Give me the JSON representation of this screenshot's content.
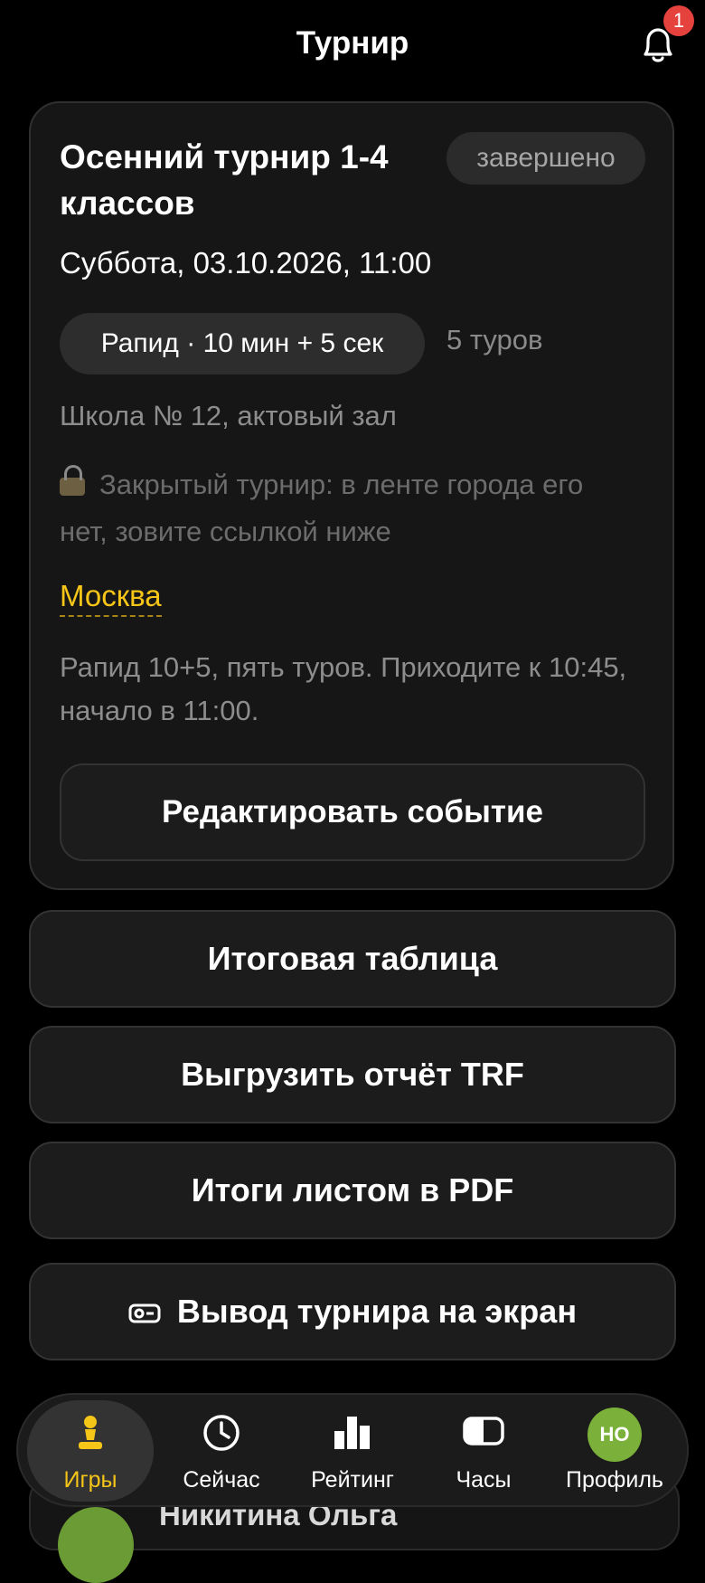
{
  "header": {
    "title": "Турнир",
    "notifications_count": "1"
  },
  "event": {
    "title": "Осенний турнир 1-4 классов",
    "status": "завершено",
    "datetime": "Суббота, 03.10.2026, 11:00",
    "time_control": "Рапид · 10 мин + 5 сек",
    "rounds": "5 туров",
    "venue": "Школа № 12, актовый зал",
    "private_note": "Закрытый турнир: в ленте города его нет, зовите ссылкой ниже",
    "city": "Москва",
    "description": "Рапид 10+5, пять туров. Приходите к 10:45, начало в 11:00.",
    "edit_label": "Редактировать событие"
  },
  "actions": {
    "standings": "Итоговая таблица",
    "export_trf": "Выгрузить отчёт TRF",
    "results_pdf": "Итоги листом в PDF",
    "display": "Вывод турнира на экран"
  },
  "peek": {
    "name": "Никитина Ольга"
  },
  "tabs": [
    {
      "label": "Игры",
      "icon": "pawn-icon",
      "active": true
    },
    {
      "label": "Сейчас",
      "icon": "clock-icon"
    },
    {
      "label": "Рейтинг",
      "icon": "bar-chart-icon"
    },
    {
      "label": "Часы",
      "icon": "chess-clock-icon"
    },
    {
      "label": "Профиль",
      "icon": "avatar",
      "initials": "НО"
    }
  ],
  "colors": {
    "accent": "#f5c518",
    "badge": "#e5423d",
    "avatar": "#7bb03b"
  }
}
